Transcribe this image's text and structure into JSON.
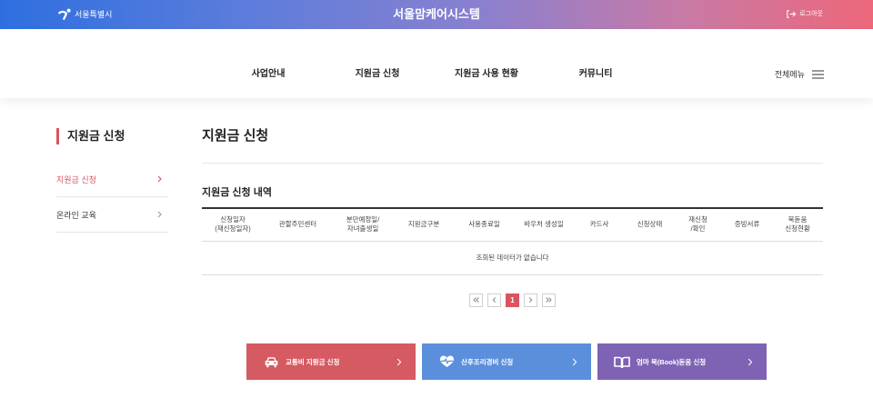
{
  "colors": {
    "accent": "#d9545f",
    "action_red": "#d65a62",
    "action_blue": "#5b8fdc",
    "action_purple": "#7e62b4",
    "topbar_start": "#2e6fe0",
    "topbar_mid": "#8a80cf",
    "topbar_end": "#ec677a"
  },
  "topbar": {
    "logo_icon": "seoul-logo-icon",
    "logo_text": "서울특별시",
    "title": "서울맘케어시스템",
    "logout_icon": "logout-icon",
    "logout_label": "로그아웃"
  },
  "nav": {
    "items": [
      {
        "label": "사업안내"
      },
      {
        "label": "지원금 신청"
      },
      {
        "label": "지원금 사용 현황"
      },
      {
        "label": "커뮤니티"
      }
    ],
    "all_menu_label": "전체메뉴",
    "all_menu_icon": "hamburger-icon"
  },
  "sidebar": {
    "title": "지원금 신청",
    "items": [
      {
        "label": "지원금 신청",
        "active": true,
        "icon": "chevron-right-icon"
      },
      {
        "label": "온라인 교육",
        "active": false,
        "icon": "chevron-right-icon"
      }
    ]
  },
  "main": {
    "page_title": "지원금 신청",
    "section_title": "지원금 신청 내역",
    "table": {
      "headers": [
        {
          "lines": [
            "신청일자",
            "(재신청일자)"
          ]
        },
        {
          "lines": [
            "관할주민센터"
          ]
        },
        {
          "lines": [
            "분만예정일/",
            "자녀출생일"
          ]
        },
        {
          "lines": [
            "지원금구분"
          ]
        },
        {
          "lines": [
            "사용종료일"
          ]
        },
        {
          "lines": [
            "바우처 생성일"
          ]
        },
        {
          "lines": [
            "카드사"
          ]
        },
        {
          "lines": [
            "신청상태"
          ]
        },
        {
          "lines": [
            "재신청",
            "/확인"
          ]
        },
        {
          "lines": [
            "증빙서류"
          ]
        },
        {
          "lines": [
            "북돋움",
            "신청현황"
          ]
        }
      ],
      "rows": [],
      "empty_message": "조회된 데이터가 없습니다"
    },
    "pagination": {
      "first_icon": "double-chevron-left-icon",
      "prev_icon": "chevron-left-icon",
      "current_page": "1",
      "next_icon": "chevron-right-icon",
      "last_icon": "double-chevron-right-icon"
    },
    "actions": [
      {
        "label": "교통비 지원금 신청",
        "icon": "car-icon"
      },
      {
        "label": "산후조리경비 신청",
        "icon": "heart-pulse-icon"
      },
      {
        "label": "엄마 북(Book)돋움 신청",
        "icon": "book-icon"
      }
    ]
  }
}
